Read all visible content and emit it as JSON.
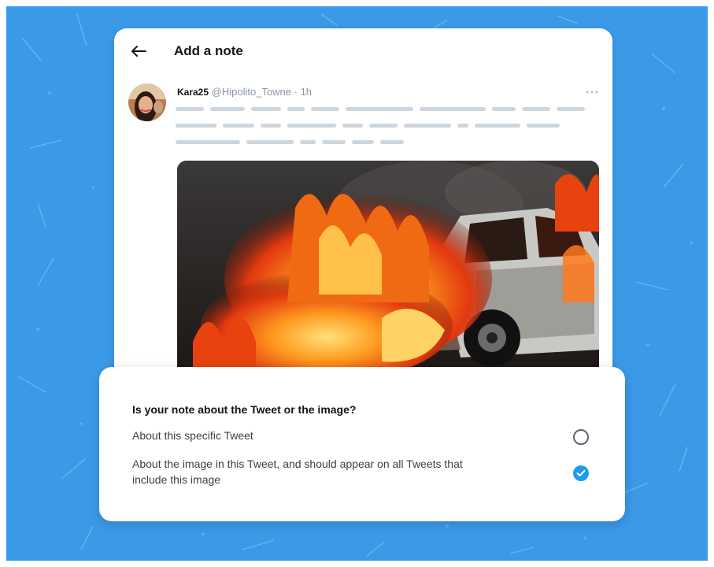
{
  "header": {
    "title": "Add a note",
    "back_icon": "arrow-left-icon"
  },
  "tweet": {
    "name": "Kara25",
    "handle": "@Hipolito_Towne",
    "time": "· 1h",
    "more_icon": "more-horizontal-icon",
    "media_description_icon": "image-burning-car"
  },
  "panel": {
    "question": "Is your note about the Tweet or the image?",
    "options": [
      {
        "label": "About this specific Tweet",
        "selected": false
      },
      {
        "label": "About the image in this Tweet, and should appear on all Tweets that include this image",
        "selected": true
      }
    ]
  },
  "colors": {
    "background": "#3b9ae8",
    "accent": "#1d9bf0",
    "placeholder_line": "#cdd6de"
  }
}
